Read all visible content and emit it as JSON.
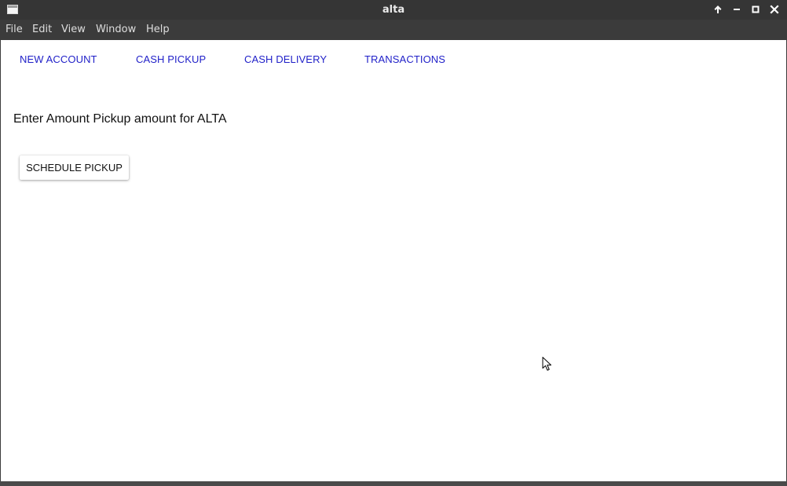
{
  "window": {
    "title": "alta",
    "controls": [
      "arrow-up-icon",
      "minimize-icon",
      "maximize-icon",
      "close-icon"
    ]
  },
  "menubar": {
    "items": [
      "File",
      "Edit",
      "View",
      "Window",
      "Help"
    ]
  },
  "nav": {
    "links": [
      "NEW ACCOUNT",
      "CASH PICKUP",
      "CASH DELIVERY",
      "TRANSACTIONS"
    ],
    "link_color": "#1f1fc8"
  },
  "main": {
    "prompt": "Enter Amount Pickup amount for ALTA",
    "schedule_button": "SCHEDULE PICKUP"
  },
  "colors": {
    "titlebar": "#353535",
    "background": "#ffffff"
  }
}
